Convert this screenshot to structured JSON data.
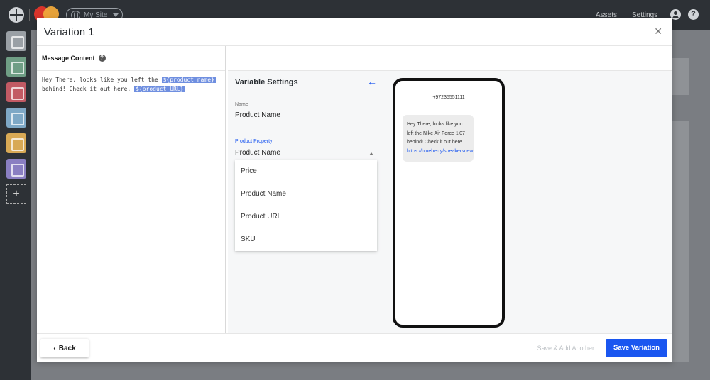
{
  "topbar": {
    "site_label": "My Site",
    "assets_label": "Assets",
    "settings_label": "Settings",
    "help_glyph": "?",
    "icons": [
      "grid-logo-icon",
      "brand-logo-icon",
      "globe-icon",
      "chevron-down-icon",
      "user-icon",
      "help-icon"
    ]
  },
  "rail": {
    "tiles": [
      {
        "name": "dashboard",
        "color": "#9aa0a6"
      },
      {
        "name": "audience",
        "color": "#6f9e85"
      },
      {
        "name": "campaigns",
        "color": "#c25a64"
      },
      {
        "name": "content",
        "color": "#7ea8c6"
      },
      {
        "name": "messages",
        "color": "#d8a955"
      },
      {
        "name": "automation",
        "color": "#8a7fc2"
      }
    ],
    "add_label": "+"
  },
  "modal": {
    "title": "Variation 1",
    "close_glyph": "✕",
    "message_content": {
      "heading": "Message Content",
      "help_glyph": "?",
      "text_before": "Hey There, looks like you left the ",
      "tag_product_name": "${product name}",
      "text_middle": " behind! Check it out here. ",
      "tag_product_url": "${product URL}"
    },
    "variable_settings": {
      "title": "Variable Settings",
      "back_glyph": "←",
      "name_label": "Name",
      "name_value": "Product Name",
      "property_label": "Product Property",
      "property_value": "Product Name",
      "options": [
        "Price",
        "Product Name",
        "Product URL",
        "SKU"
      ]
    },
    "preview": {
      "phone_number": "+97235551111",
      "message_text": "Hey There, looks like you left the Nike Air Force 1'07 behind! Check it out here.",
      "message_link": "https://blueberry/sneakersnew"
    },
    "footer": {
      "back_label": "Back",
      "back_glyph": "‹",
      "save_add_another_label": "Save & Add Another",
      "save_variation_label": "Save Variation"
    }
  },
  "colors": {
    "primary": "#1a56f0",
    "topbar": "#2d3136",
    "tag": "#6f8fe0"
  }
}
